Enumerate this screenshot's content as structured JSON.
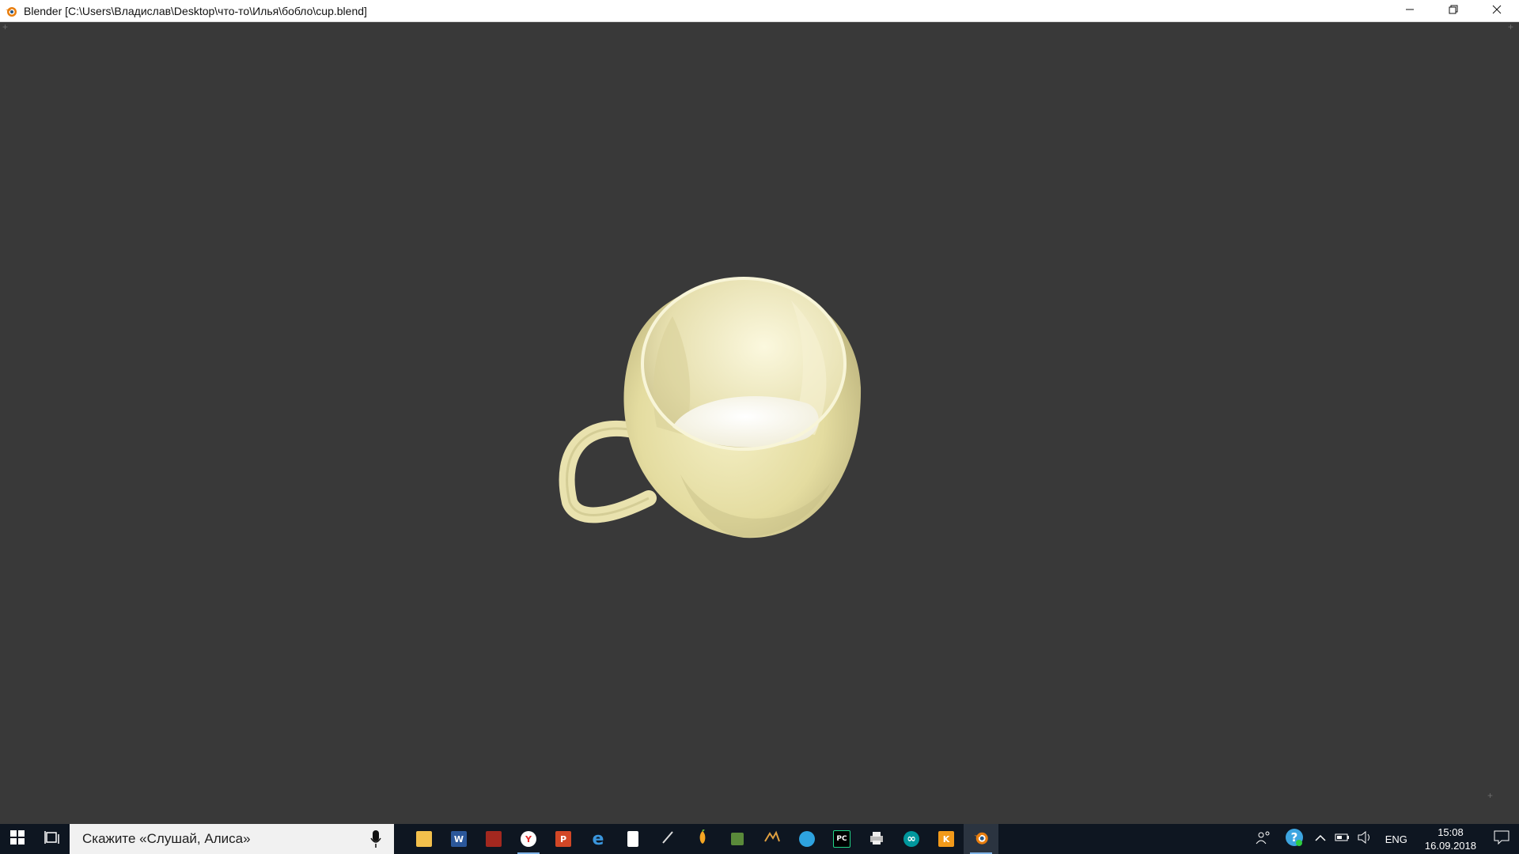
{
  "window": {
    "title": "Blender [C:\\Users\\Владислав\\Desktop\\что-то\\Илья\\бобло\\cup.blend]",
    "icon": "blender-icon",
    "controls": [
      "minimize-icon",
      "restore-icon",
      "close-icon"
    ]
  },
  "viewport": {
    "background": "#393939",
    "object": "cup",
    "cup_color": "#eee9b8"
  },
  "taskbar": {
    "search_placeholder": "Скажите «Слушай, Алиса»",
    "apps": [
      {
        "name": "file-explorer",
        "label": ""
      },
      {
        "name": "word",
        "label": "W"
      },
      {
        "name": "app-red",
        "label": ""
      },
      {
        "name": "yandex-browser",
        "label": "Y"
      },
      {
        "name": "powerpoint",
        "label": "P"
      },
      {
        "name": "edge",
        "label": "e"
      },
      {
        "name": "notepad",
        "label": ""
      },
      {
        "name": "pen-app",
        "label": ""
      },
      {
        "name": "fl-studio",
        "label": ""
      },
      {
        "name": "minecraft",
        "label": ""
      },
      {
        "name": "game-app",
        "label": ""
      },
      {
        "name": "app-blue",
        "label": ""
      },
      {
        "name": "pycharm",
        "label": "PC"
      },
      {
        "name": "app-printer",
        "label": ""
      },
      {
        "name": "arduino",
        "label": "∞"
      },
      {
        "name": "app-orange",
        "label": "K"
      },
      {
        "name": "blender",
        "label": ""
      }
    ],
    "tray": {
      "language": "ENG",
      "time": "15:08",
      "date": "16.09.2018"
    }
  }
}
